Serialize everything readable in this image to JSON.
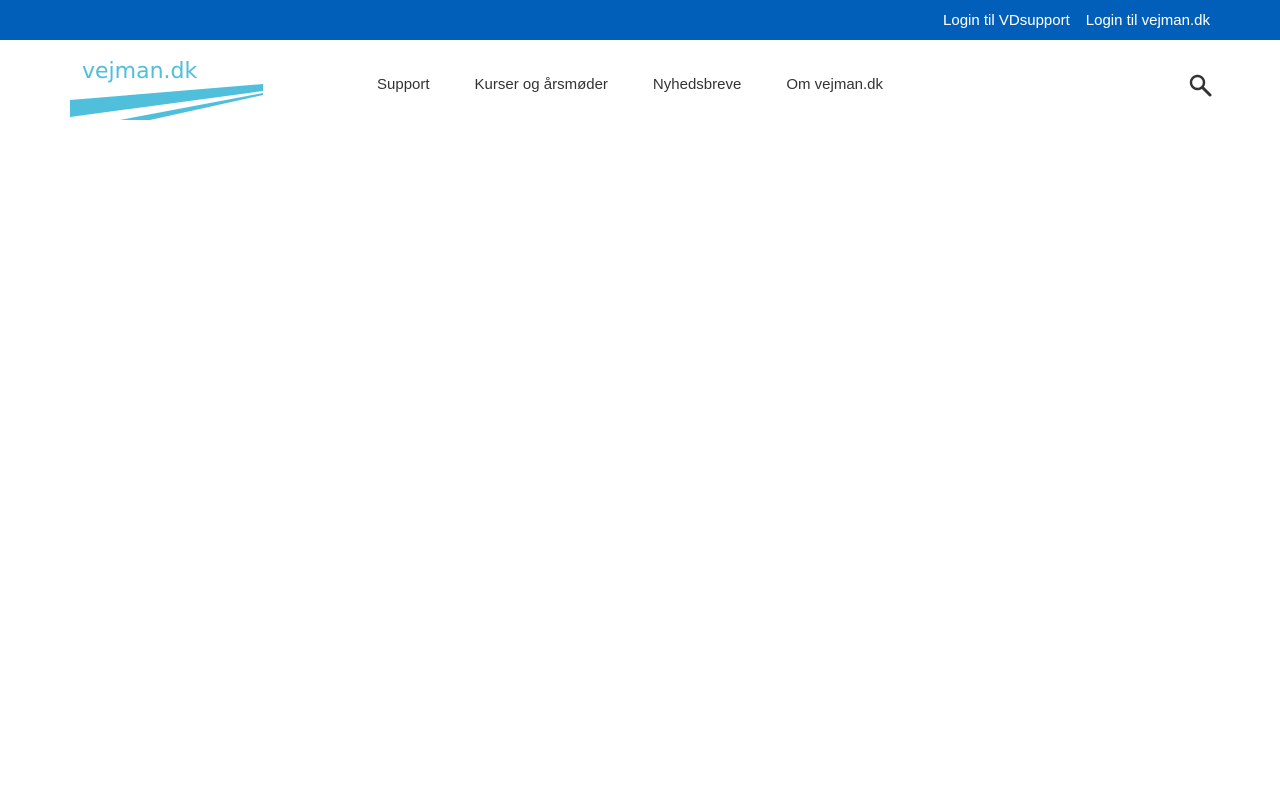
{
  "topbar": {
    "links": [
      "Login til VDsupport",
      "Login til vejman.dk"
    ]
  },
  "logo": {
    "text": "vejman.dk",
    "color": "#4fbfdc"
  },
  "nav": {
    "items": [
      "Support",
      "Kurser og årsmøder",
      "Nyhedsbreve",
      "Om vejman.dk"
    ]
  },
  "icons": {
    "search": "search-icon"
  }
}
